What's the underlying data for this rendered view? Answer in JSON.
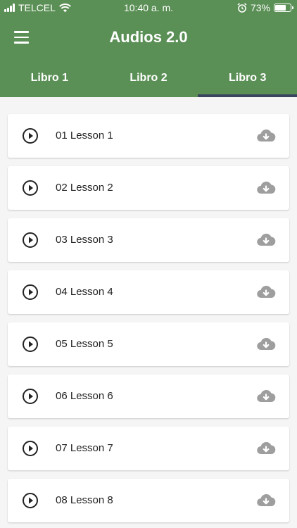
{
  "status": {
    "carrier": "TELCEL",
    "time": "10:40 a. m.",
    "battery": "73%",
    "battery_level": 0.73
  },
  "app": {
    "title": "Audios 2.0"
  },
  "tabs": [
    {
      "label": "Libro 1"
    },
    {
      "label": "Libro 2"
    },
    {
      "label": "Libro 3"
    }
  ],
  "active_tab": 2,
  "lessons": [
    {
      "label": "01 Lesson 1"
    },
    {
      "label": "02 Lesson 2"
    },
    {
      "label": "03 Lesson 3"
    },
    {
      "label": "04 Lesson 4"
    },
    {
      "label": "05 Lesson 5"
    },
    {
      "label": "06 Lesson 6"
    },
    {
      "label": "07 Lesson 7"
    },
    {
      "label": "08 Lesson 8"
    }
  ],
  "colors": {
    "header": "#5a8f55",
    "tab_indicator": "#3a4660",
    "icon_gray": "#9e9e9e"
  },
  "icons": {
    "item_left": "play-circle-icon",
    "item_right": "cloud-download-icon"
  }
}
